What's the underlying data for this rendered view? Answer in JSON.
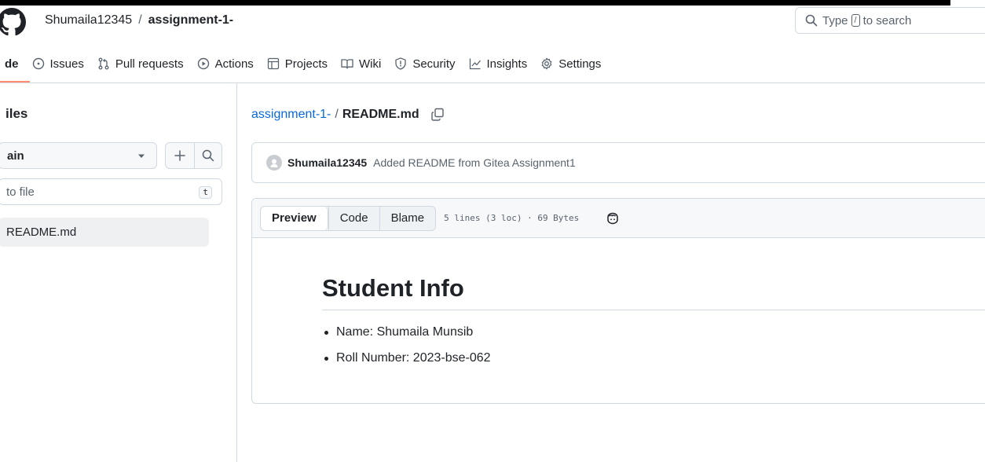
{
  "header": {
    "owner": "Shumaila12345",
    "separator": "/",
    "repo": "assignment-1-",
    "search": {
      "prefix": "Type",
      "key": "/",
      "suffix": "to search"
    }
  },
  "nav": {
    "items": [
      {
        "label": "de",
        "icon": "code-icon"
      },
      {
        "label": "Issues",
        "icon": "issue-circle-icon"
      },
      {
        "label": "Pull requests",
        "icon": "pull-request-icon"
      },
      {
        "label": "Actions",
        "icon": "play-circle-icon"
      },
      {
        "label": "Projects",
        "icon": "table-icon"
      },
      {
        "label": "Wiki",
        "icon": "book-icon"
      },
      {
        "label": "Security",
        "icon": "shield-icon"
      },
      {
        "label": "Insights",
        "icon": "graph-icon"
      },
      {
        "label": "Settings",
        "icon": "gear-icon"
      }
    ]
  },
  "sidebar": {
    "title": "iles",
    "branch": "ain",
    "goto_placeholder": "to file",
    "goto_key": "t",
    "files": [
      "README.md"
    ]
  },
  "main": {
    "breadcrumb": {
      "repo": "assignment-1-",
      "slash": "/",
      "file": "README.md"
    },
    "commit": {
      "author": "Shumaila12345",
      "message": "Added README from Gitea Assignment1"
    },
    "file_header": {
      "tabs": [
        "Preview",
        "Code",
        "Blame"
      ],
      "active_tab": "Preview",
      "meta": "5 lines (3 loc) · 69 Bytes"
    },
    "readme": {
      "heading": "Student Info",
      "items": [
        "Name: Shumaila Munsib",
        "Roll Number: 2023-bse-062"
      ]
    }
  },
  "colors": {
    "link": "#0969da",
    "underline": "#fd8c73",
    "border": "#d1d9e0",
    "muted": "#59636e"
  }
}
